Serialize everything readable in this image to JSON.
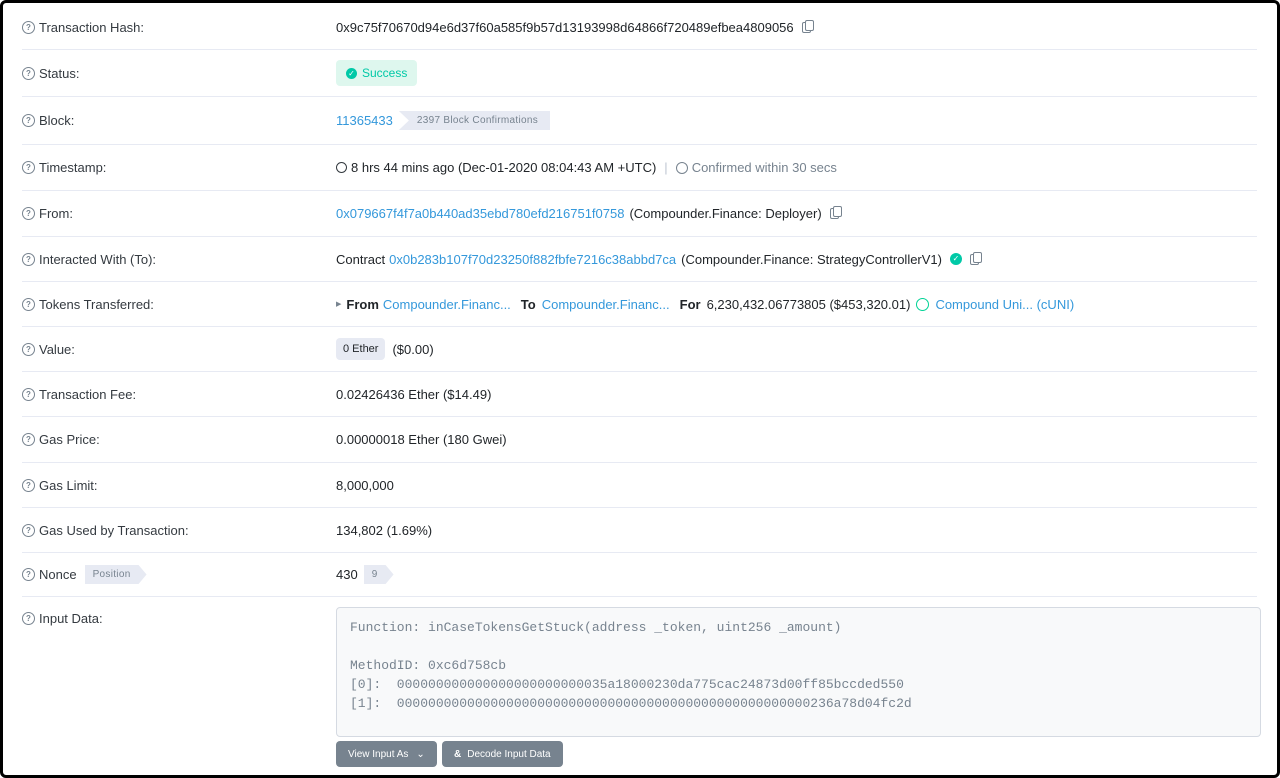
{
  "help_glyph": "?",
  "rows": {
    "hash": {
      "label": "Transaction Hash:",
      "value": "0x9c75f70670d94e6d37f60a585f9b57d13193998d64866f720489efbea4809056"
    },
    "status": {
      "label": "Status:",
      "value": "Success"
    },
    "block": {
      "label": "Block:",
      "number": "11365433",
      "confirmations": "2397 Block Confirmations"
    },
    "timestamp": {
      "label": "Timestamp:",
      "value": "8 hrs 44 mins ago (Dec-01-2020 08:04:43 AM +UTC)",
      "separator": "|",
      "confirmed": "Confirmed within 30 secs"
    },
    "from": {
      "label": "From:",
      "address": "0x079667f4f7a0b440ad35ebd780efd216751f0758",
      "name": "(Compounder.Finance: Deployer)"
    },
    "to": {
      "label": "Interacted With (To):",
      "prefix": "Contract",
      "address": "0x0b283b107f70d23250f882fbfe7216c38abbd7ca",
      "name": "(Compounder.Finance: StrategyControllerV1)"
    },
    "tokens": {
      "label": "Tokens Transferred:",
      "from_kw": "From",
      "from": "Compounder.Financ...",
      "to_kw": "To",
      "to": "Compounder.Financ...",
      "for_kw": "For",
      "amount": "6,230,432.06773805 ($453,320.01)",
      "token": "Compound Uni... (cUNI)"
    },
    "value": {
      "label": "Value:",
      "ether": "0 Ether",
      "usd": "($0.00)"
    },
    "fee": {
      "label": "Transaction Fee:",
      "value": "0.02426436 Ether ($14.49)"
    },
    "gas_price": {
      "label": "Gas Price:",
      "value": "0.00000018 Ether (180 Gwei)"
    },
    "gas_limit": {
      "label": "Gas Limit:",
      "value": "8,000,000"
    },
    "gas_used": {
      "label": "Gas Used by Transaction:",
      "value": "134,802 (1.69%)"
    },
    "nonce": {
      "label": "Nonce",
      "position_label": "Position",
      "value": "430",
      "position": "9"
    },
    "input": {
      "label": "Input Data:",
      "text": "Function: inCaseTokensGetStuck(address _token, uint256 _amount)\n\nMethodID: 0xc6d758cb\n[0]:  000000000000000000000000035a18000230da775cac24873d00ff85bccded550\n[1]:  00000000000000000000000000000000000000000000000000000236a78d04fc2d",
      "view_as_label": "View Input As",
      "view_as_caret": "⌄",
      "decode_label": "Decode Input Data"
    }
  },
  "colors": {
    "link": "#3498db",
    "success": "#00c9a7",
    "border": "#e7eaf3"
  }
}
